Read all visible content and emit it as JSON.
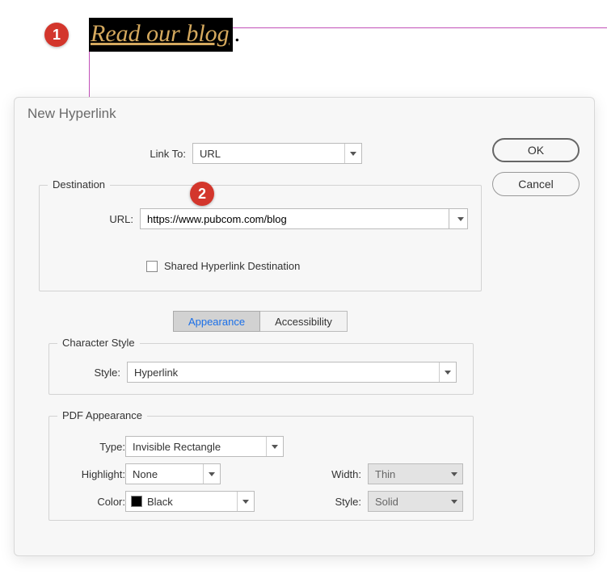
{
  "callouts": {
    "one": "1",
    "two": "2"
  },
  "document": {
    "selected_text": "Read our blog",
    "trailing": "."
  },
  "dialog": {
    "title": "New Hyperlink",
    "ok": "OK",
    "cancel": "Cancel",
    "link_to_label": "Link To:",
    "link_to_value": "URL",
    "destination": {
      "legend": "Destination",
      "url_label": "URL:",
      "url_value": "https://www.pubcom.com/blog",
      "shared_label": "Shared Hyperlink Destination"
    },
    "tabs": {
      "appearance": "Appearance",
      "accessibility": "Accessibility"
    },
    "character_style": {
      "legend": "Character Style",
      "style_label": "Style:",
      "style_value": "Hyperlink"
    },
    "pdf": {
      "legend": "PDF Appearance",
      "type_label": "Type:",
      "type_value": "Invisible Rectangle",
      "highlight_label": "Highlight:",
      "highlight_value": "None",
      "width_label": "Width:",
      "width_value": "Thin",
      "color_label": "Color:",
      "color_value": "Black",
      "style_label": "Style:",
      "style_value": "Solid"
    }
  }
}
